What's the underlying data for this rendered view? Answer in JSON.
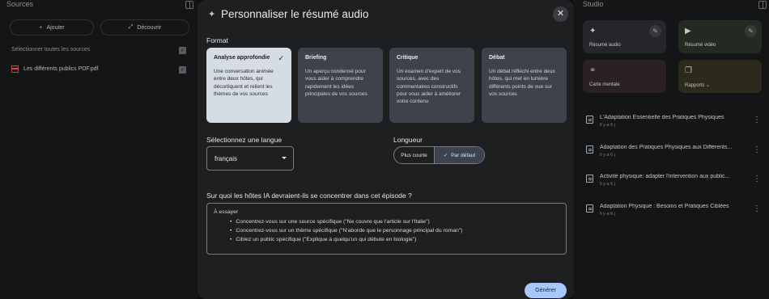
{
  "sources": {
    "title": "Sources",
    "add_label": "Ajouter",
    "discover_label": "Découvrir",
    "select_all_label": "Sélectionner toutes les sources",
    "items": [
      {
        "name": "Les différents publics PDF.pdf",
        "checked": true
      }
    ]
  },
  "studio": {
    "title": "Studio",
    "tiles": [
      {
        "label": "Résumé audio",
        "icon": "sparkle-icon",
        "color": "#24262c"
      },
      {
        "label": "Résumé vidéo",
        "icon": "video-icon",
        "color": "#242a22"
      },
      {
        "label": "Carte mentale",
        "icon": "mindmap-icon",
        "color": "#2a2125"
      },
      {
        "label": "Rapports",
        "icon": "report-icon",
        "color": "#2b2a1d"
      }
    ],
    "notes": [
      {
        "title": "L'Adaptation Essentielle des Pratiques Physiques",
        "time": "Il y a 6 j"
      },
      {
        "title": "Adaptation des Pratiques Physiques aux Différents...",
        "time": "Il y a 6 j"
      },
      {
        "title": "Activité physique: adapter l'intervention aux public...",
        "time": "Il y a 6 j"
      },
      {
        "title": "Adaptation Physique : Besoins et Pratiques Ciblées",
        "time": "Il y a 6 j"
      }
    ]
  },
  "modal": {
    "title": "Personnaliser le résumé audio",
    "format_label": "Format",
    "formats": [
      {
        "title": "Analyse approfondie",
        "desc": "Une conversation animée entre deux hôtes, qui décortiquent et relient les thèmes de vos sources",
        "selected": true
      },
      {
        "title": "Briefing",
        "desc": "Un aperçu condensé pour vous aider à comprendre rapidement les idées principales de vos sources",
        "selected": false
      },
      {
        "title": "Critique",
        "desc": "Un examen d'expert de vos sources, avec des commentaires constructifs pour vous aider à améliorer votre contenu",
        "selected": false
      },
      {
        "title": "Débat",
        "desc": "Un débat réfléchi entre deux hôtes, qui met en lumière différents points de vue sur vos sources",
        "selected": false
      }
    ],
    "language_label": "Sélectionnez une langue",
    "language_value": "français",
    "length_label": "Longueur",
    "length_options": [
      "Plus courte",
      "Par défaut"
    ],
    "length_selected": "Par défaut",
    "focus_question": "Sur quoi les hôtes IA devraient-ils se concentrer dans cet épisode ?",
    "focus_heading": "À essayer",
    "focus_tips": [
      "Concentrez-vous sur une source spécifique (\"Ne couvre que l'article sur l'Italie\")",
      "Concentrez-vous sur un thème spécifique (\"N'aborde que le personnage principal du roman\")",
      "Ciblez un public spécifique (\"Explique à quelqu'un qui débute en biologie\")"
    ],
    "generate_label": "Générer"
  }
}
